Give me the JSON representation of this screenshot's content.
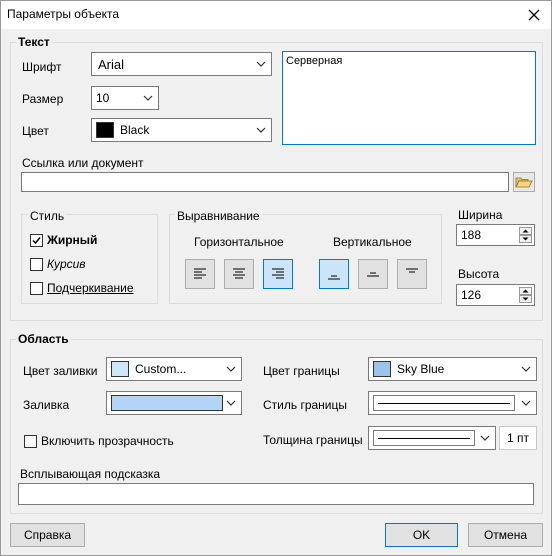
{
  "window": {
    "title": "Параметры объекта"
  },
  "text_group": {
    "title": "Текст",
    "font_label": "Шрифт",
    "font_value": "Arial",
    "size_label": "Размер",
    "size_value": "10",
    "color_label": "Цвет",
    "color_value": "Black",
    "color_swatch": "#000000",
    "preview_text": "Серверная",
    "link_label": "Ссылка или документ",
    "link_value": ""
  },
  "style_group": {
    "title": "Стиль",
    "bold": {
      "label": "Жирный",
      "checked": true
    },
    "italic": {
      "label": "Курсив",
      "checked": false
    },
    "underline": {
      "label": "Подчеркивание",
      "checked": false
    }
  },
  "alignment_group": {
    "title": "Выравнивание",
    "horizontal_label": "Горизонтальное",
    "vertical_label": "Вертикальное",
    "horizontal_selected": "right",
    "vertical_selected": "bottom"
  },
  "size_fields": {
    "width_label": "Ширина",
    "width_value": "188",
    "height_label": "Высота",
    "height_value": "126"
  },
  "area_group": {
    "title": "Область",
    "fill_color_label": "Цвет заливки",
    "fill_color_value": "Custom...",
    "fill_color_swatch": "#cfe6fb",
    "fill_label": "Заливка",
    "fill_swatch": "#b3d4f5",
    "border_color_label": "Цвет границы",
    "border_color_value": "Sky Blue",
    "border_color_swatch": "#9bc4ec",
    "border_style_label": "Стиль границы",
    "border_width_label": "Толщина границы",
    "border_width_value": "1 пт",
    "transparency_label": "Включить прозрачность",
    "transparency_checked": false,
    "tooltip_label": "Всплывающая подсказка",
    "tooltip_value": ""
  },
  "buttons": {
    "help": "Справка",
    "ok": "OK",
    "cancel": "Отмена"
  },
  "accent_color": "#0078d7"
}
